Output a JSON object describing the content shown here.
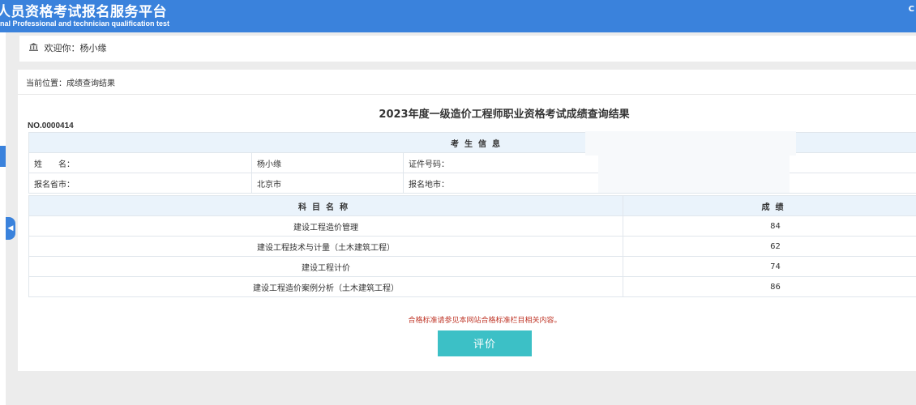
{
  "header": {
    "title_cn": "人员资格考试报名服务平台",
    "title_en": "nal Professional and technician qualification test",
    "corner": "C"
  },
  "welcome": {
    "label": "欢迎你：杨小缘"
  },
  "breadcrumb": {
    "text": "当前位置：成绩查询结果"
  },
  "result": {
    "title": "2023年度一级造价工程师职业资格考试成绩查询结果",
    "cert_no": "NO.0000414",
    "info_header": "考生信息",
    "name_label": "姓　　名：",
    "name_value": "杨小缘",
    "id_label": "证件号码：",
    "province_label": "报名省市：",
    "province_value": "北京市",
    "city_label": "报名地市：",
    "subject_header": "科目名称",
    "score_header": "成绩",
    "rows": [
      {
        "subject": "建设工程造价管理",
        "score": "84"
      },
      {
        "subject": "建设工程技术与计量（土木建筑工程）",
        "score": "62"
      },
      {
        "subject": "建设工程计价",
        "score": "74"
      },
      {
        "subject": "建设工程造价案例分析（土木建筑工程）",
        "score": "86"
      }
    ],
    "note": "合格标准请参见本网站合格标准栏目相关内容。",
    "button_label": "评价"
  },
  "colors": {
    "header_bg": "#3a82dc",
    "table_head_bg": "#eaf3fb",
    "button_bg": "#3cc0c6",
    "note_color": "#c0392b"
  },
  "icons": {
    "welcome": "bank-icon",
    "collapse": "chevron-left-icon"
  }
}
